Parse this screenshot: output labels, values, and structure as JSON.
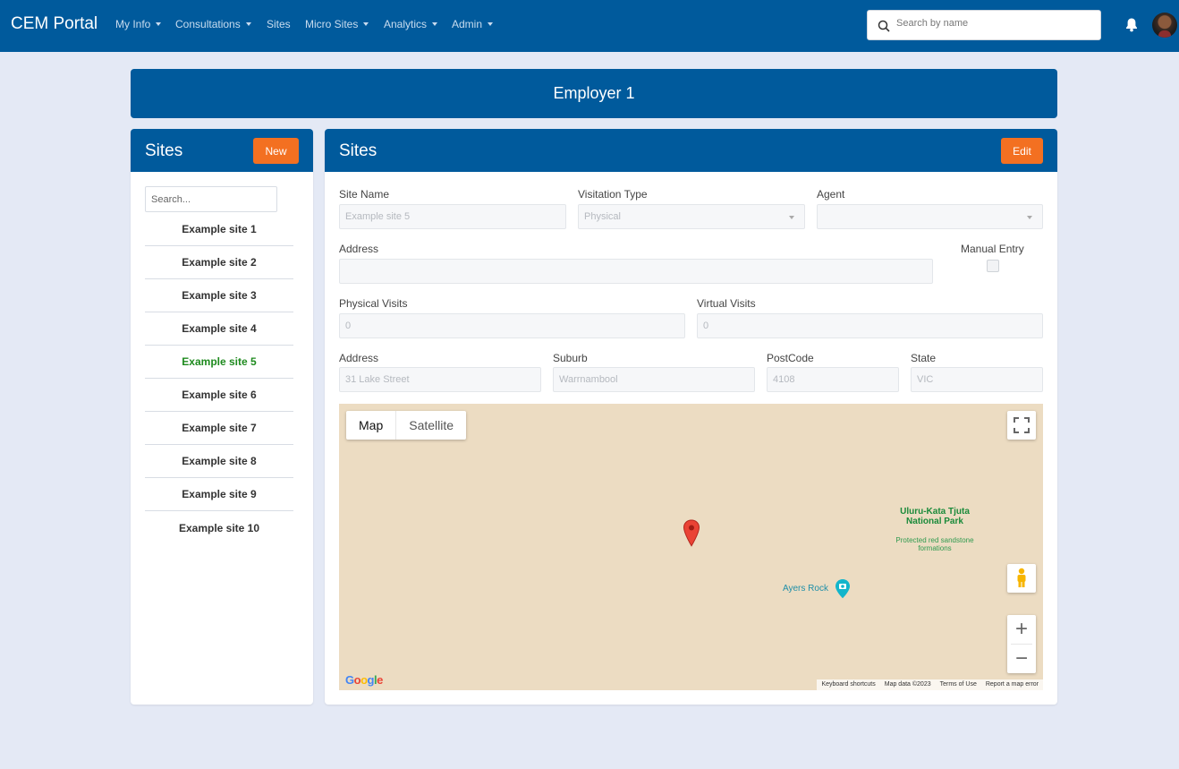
{
  "navbar": {
    "brand": "CEM Portal",
    "menu": [
      {
        "label": "My Info",
        "dropdown": true
      },
      {
        "label": "Consultations",
        "dropdown": true
      },
      {
        "label": "Sites",
        "dropdown": false
      },
      {
        "label": "Micro Sites",
        "dropdown": true
      },
      {
        "label": "Analytics",
        "dropdown": true
      },
      {
        "label": "Admin",
        "dropdown": true
      }
    ],
    "search_placeholder": "Search by name",
    "icons": {
      "search": "search-icon",
      "bell": "bell-icon",
      "avatar": "user-avatar"
    }
  },
  "employer": {
    "title": "Employer 1"
  },
  "sites_panel": {
    "title": "Sites",
    "new_label": "New",
    "search_placeholder": "Search...",
    "items": [
      "Example site 1",
      "Example site 2",
      "Example site 3",
      "Example site 4",
      "Example site 5",
      "Example site 6",
      "Example site 7",
      "Example site 8",
      "Example site 9",
      "Example site 10"
    ],
    "selected": "Example site 5",
    "selected_color": "#1e8a1e"
  },
  "detail": {
    "title": "Sites",
    "edit_label": "Edit",
    "site_name": {
      "label": "Site Name",
      "value": "Example site 5"
    },
    "visitation_type": {
      "label": "Visitation Type",
      "value": "Physical"
    },
    "agent": {
      "label": "Agent",
      "value": ""
    },
    "address_full": {
      "label": "Address",
      "value": ""
    },
    "manual_entry": {
      "label": "Manual Entry",
      "checked": false
    },
    "physical_visits": {
      "label": "Physical Visits",
      "value": "0"
    },
    "virtual_visits": {
      "label": "Virtual Visits",
      "value": "0"
    },
    "address": {
      "label": "Address",
      "value": "31 Lake Street"
    },
    "suburb": {
      "label": "Suburb",
      "value": "Warrnambool"
    },
    "postcode": {
      "label": "PostCode",
      "value": "4108"
    },
    "state": {
      "label": "State",
      "value": "VIC"
    }
  },
  "map": {
    "tabs": [
      "Map",
      "Satellite"
    ],
    "active_tab": "Map",
    "park_name": "Uluru-Kata Tjuta National Park",
    "park_desc": "Protected red sandstone formations",
    "poi": "Ayers Rock",
    "google": "Google",
    "attribution": [
      "Keyboard shortcuts",
      "Map data ©2023",
      "Terms of Use",
      "Report a map error"
    ],
    "zoom_in": "+",
    "zoom_out": "−"
  },
  "colors": {
    "primary": "#005a9c",
    "accent": "#f37021",
    "background": "#e4e9f5"
  }
}
